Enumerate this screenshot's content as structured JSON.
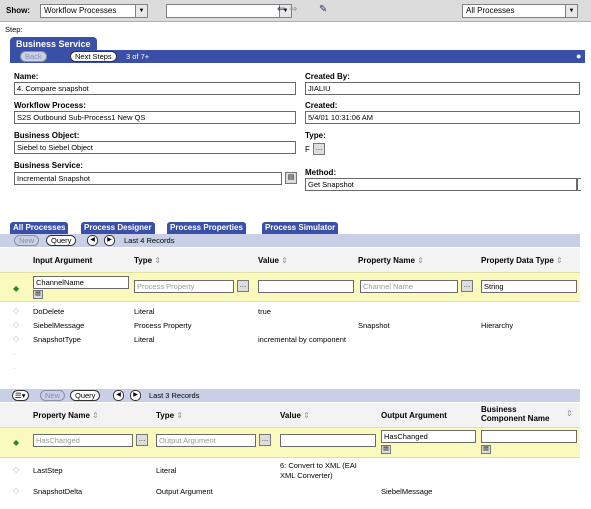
{
  "toolbar": {
    "show_label": "Show:",
    "show_value": "Workflow Processes",
    "second_value": "",
    "right_value": "All Processes"
  },
  "step_label": "Step:",
  "header": {
    "title": "Business Service",
    "back_label": "Back",
    "next_label": "Next Steps",
    "count": "3 of 7+"
  },
  "form": {
    "name_label": "Name:",
    "name_value": "4. Compare snapshot",
    "wf_label": "Workflow Process:",
    "wf_value": "S2S Outbound Sub-Process1 New QS",
    "bo_label": "Business Object:",
    "bo_value": "Siebel to Siebel Object",
    "bs_label": "Business Service:",
    "bs_value": "Incremental Snapshot",
    "cb_label": "Created By:",
    "cb_value": "JIALIU",
    "created_label": "Created:",
    "created_value": "5/4/01 10:31:06 AM",
    "type_label": "Type:",
    "type_value": "F",
    "method_label": "Method:",
    "method_value": "Get Snapshot"
  },
  "tabs": [
    "All Processes",
    "Process Designer",
    "Process Properties",
    "Process Simulator"
  ],
  "input_list": {
    "new_label": "New",
    "query_label": "Query",
    "records": "Last 4 Records",
    "col_input": "Input Argument",
    "col_type": "Type",
    "col_value": "Value",
    "col_prop": "Property Name",
    "col_ptype": "Property Data Type",
    "edit_row": {
      "input": "ChannelName",
      "type": "Process Property",
      "value": "",
      "prop": "Channel Name",
      "ptype": "String"
    },
    "rows": [
      {
        "input": "DoDelete",
        "type": "Literal",
        "value": "true",
        "prop": "",
        "ptype": ""
      },
      {
        "input": "SiebelMessage",
        "type": "Process Property",
        "value": "",
        "prop": "Snapshot",
        "ptype": "Hierarchy"
      },
      {
        "input": "SnapshotType",
        "type": "Literal",
        "value": "incremental by component",
        "prop": "",
        "ptype": ""
      }
    ]
  },
  "output_list": {
    "new_label": "New",
    "query_label": "Query",
    "records": "Last 3 Records",
    "col_prop": "Property Name",
    "col_type": "Type",
    "col_value": "Value",
    "col_output": "Output Argument",
    "col_bc_1": "Business",
    "col_bc_2": "Component Name",
    "edit_row": {
      "prop": "HasChanged",
      "type": "Output Argument",
      "value": "",
      "output": "HasChanged",
      "bc": ""
    },
    "rows": [
      {
        "prop": "LastStep",
        "type": "Literal",
        "value_1": "6: Convert to XML (EAI",
        "value_2": "XML Converter)",
        "output": ""
      },
      {
        "prop": "SnapshotDelta",
        "type": "Output Argument",
        "value_1": "",
        "value_2": "",
        "output": "SiebelMessage"
      }
    ]
  }
}
